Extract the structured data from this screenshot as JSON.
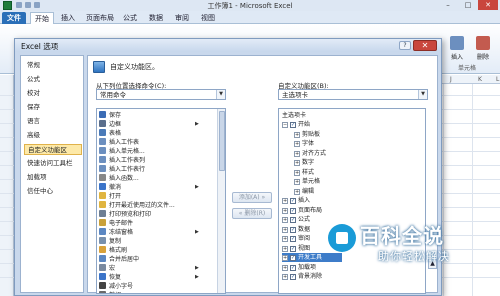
{
  "window": {
    "title": "工作簿1 - Microsoft Excel",
    "minimize": "–",
    "maximize": "□",
    "close": "✕"
  },
  "ribbon": {
    "tabs": [
      "文件",
      "开始",
      "插入",
      "页面布局",
      "公式",
      "数据",
      "审阅",
      "视图"
    ],
    "right_buttons": [
      "插入",
      "删除"
    ],
    "group_label": "单元格"
  },
  "dialog": {
    "title": "Excel 选项",
    "help": "?",
    "close": "✕",
    "nav": [
      "常规",
      "公式",
      "校对",
      "保存",
      "语言",
      "高级",
      "自定义功能区",
      "快速访问工具栏",
      "加载项",
      "信任中心"
    ],
    "nav_selected_index": 6,
    "header": "自定义功能区。",
    "left": {
      "label": "从下列位置选择命令(C):",
      "combo_value": "常用命令",
      "commands": [
        {
          "label": "保存",
          "icon": "save-icon",
          "color": "#3b6cb5"
        },
        {
          "label": "边框",
          "icon": "border-icon",
          "color": "#5a6e8c",
          "sub": true
        },
        {
          "label": "表格",
          "icon": "table-icon",
          "color": "#4a7ab8"
        },
        {
          "label": "插入工作表",
          "icon": "insert-sheet-icon",
          "color": "#6c8fbf"
        },
        {
          "label": "插入单元格...",
          "icon": "insert-cells-icon",
          "color": "#6c8fbf"
        },
        {
          "label": "插入工作表列",
          "icon": "insert-column-icon",
          "color": "#6c8fbf"
        },
        {
          "label": "插入工作表行",
          "icon": "insert-row-icon",
          "color": "#6c8fbf"
        },
        {
          "label": "插入函数...",
          "icon": "function-icon",
          "color": "#888"
        },
        {
          "label": "撤消",
          "icon": "undo-icon",
          "color": "#3b74c9",
          "sub": true
        },
        {
          "label": "打开",
          "icon": "open-icon",
          "color": "#e0b540"
        },
        {
          "label": "打开最近使用过的文件...",
          "icon": "recent-file-icon",
          "color": "#e0b540"
        },
        {
          "label": "打印预览和打印",
          "icon": "print-preview-icon",
          "color": "#6d7e93"
        },
        {
          "label": "电子邮件",
          "icon": "email-icon",
          "color": "#c9a13a"
        },
        {
          "label": "冻结窗格",
          "icon": "freeze-panes-icon",
          "color": "#5b87c2",
          "sub": true
        },
        {
          "label": "复制",
          "icon": "copy-icon",
          "color": "#7890ad"
        },
        {
          "label": "格式刷",
          "icon": "format-painter-icon",
          "color": "#d9a23a"
        },
        {
          "label": "合并后居中",
          "icon": "merge-center-icon",
          "color": "#5b87c2"
        },
        {
          "label": "宏",
          "icon": "macro-icon",
          "color": "#7a8aa0",
          "sub": true
        },
        {
          "label": "恢复",
          "icon": "redo-icon",
          "color": "#3b74c9",
          "sub": true
        },
        {
          "label": "减小字号",
          "icon": "decrease-font-icon",
          "color": "#444"
        },
        {
          "label": "剪切",
          "icon": "cut-icon",
          "color": "#6a6a6a"
        }
      ]
    },
    "buttons": {
      "add": "添加(A) »",
      "remove": "« 删除(R)"
    },
    "right": {
      "label": "自定义功能区(B):",
      "combo_value": "主选项卡",
      "tree_header": "主选项卡",
      "nodes": [
        {
          "label": "开始",
          "level": 0,
          "toggle": "⊟",
          "checked": true
        },
        {
          "label": "剪贴板",
          "level": 1,
          "toggle": "⊞"
        },
        {
          "label": "字体",
          "level": 1,
          "toggle": "⊞"
        },
        {
          "label": "对齐方式",
          "level": 1,
          "toggle": "⊞"
        },
        {
          "label": "数字",
          "level": 1,
          "toggle": "⊞"
        },
        {
          "label": "样式",
          "level": 1,
          "toggle": "⊞"
        },
        {
          "label": "单元格",
          "level": 1,
          "toggle": "⊞"
        },
        {
          "label": "编辑",
          "level": 1,
          "toggle": "⊞"
        },
        {
          "label": "插入",
          "level": 0,
          "toggle": "⊞",
          "checked": true
        },
        {
          "label": "页面布局",
          "level": 0,
          "toggle": "⊞",
          "checked": true
        },
        {
          "label": "公式",
          "level": 0,
          "toggle": "⊞",
          "checked": true
        },
        {
          "label": "数据",
          "level": 0,
          "toggle": "⊞",
          "checked": true
        },
        {
          "label": "审阅",
          "level": 0,
          "toggle": "⊞",
          "checked": true
        },
        {
          "label": "视图",
          "level": 0,
          "toggle": "⊞",
          "checked": true
        },
        {
          "label": "开发工具",
          "level": 0,
          "toggle": "⊞",
          "checked": true,
          "selected": true
        },
        {
          "label": "加载项",
          "level": 0,
          "toggle": "⊞",
          "checked": true
        },
        {
          "label": "背景消除",
          "level": 0,
          "toggle": "⊞",
          "checked": true
        }
      ]
    },
    "move_up": "▲"
  },
  "watermark": {
    "title": "百科全说",
    "subtitle": "助你轻松解决"
  },
  "sheet": {
    "columns": [
      "J",
      "K",
      "L"
    ]
  }
}
